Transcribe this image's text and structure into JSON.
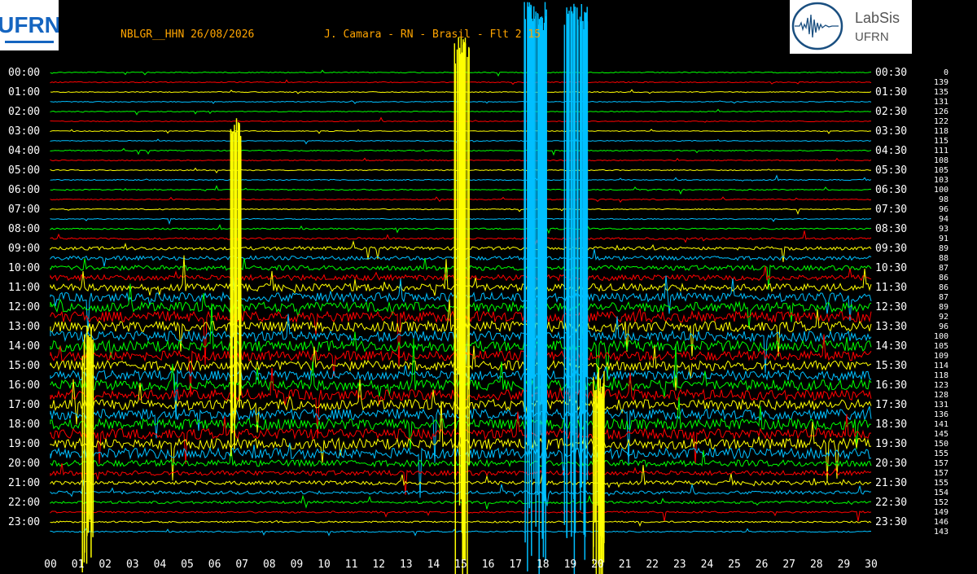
{
  "header": {
    "station": "NBLGR__HHN 26/08/2026",
    "location": "J. Camara - RN - Brasil - Flt 2 15"
  },
  "logos": {
    "left_text": "UFRN",
    "right_line1": "LabSis",
    "right_line2": "UFRN"
  },
  "chart_data": {
    "type": "helicorder",
    "station": "NBLGR__HHN",
    "date": "26/08/2026",
    "x_minutes": [
      "00",
      "01",
      "02",
      "03",
      "04",
      "05",
      "06",
      "07",
      "08",
      "09",
      "10",
      "11",
      "12",
      "13",
      "14",
      "15",
      "16",
      "17",
      "18",
      "19",
      "20",
      "21",
      "22",
      "23",
      "24",
      "25",
      "26",
      "27",
      "28",
      "29",
      "30"
    ],
    "y_left_labels": [
      "00:00",
      "01:00",
      "02:00",
      "03:00",
      "04:00",
      "05:00",
      "06:00",
      "07:00",
      "08:00",
      "09:00",
      "10:00",
      "11:00",
      "12:00",
      "13:00",
      "14:00",
      "15:00",
      "16:00",
      "17:00",
      "18:00",
      "19:00",
      "20:00",
      "21:00",
      "22:00",
      "23:00"
    ],
    "y_right_labels": [
      "00:30",
      "01:30",
      "02:30",
      "03:30",
      "04:30",
      "05:30",
      "06:30",
      "07:30",
      "08:30",
      "09:30",
      "10:30",
      "11:30",
      "12:30",
      "13:30",
      "14:30",
      "15:30",
      "16:30",
      "17:30",
      "18:30",
      "19:30",
      "20:30",
      "21:30",
      "22:30",
      "23:30"
    ],
    "trace_values": [
      "0",
      "139",
      "135",
      "131",
      "126",
      "122",
      "118",
      "115",
      "111",
      "108",
      "105",
      "103",
      "100",
      "98",
      "96",
      "94",
      "93",
      "91",
      "89",
      "88",
      "87",
      "86",
      "86",
      "87",
      "89",
      "92",
      "96",
      "100",
      "105",
      "109",
      "114",
      "118",
      "123",
      "128",
      "131",
      "136",
      "141",
      "145",
      "150",
      "155",
      "157",
      "157",
      "155",
      "154",
      "152",
      "149",
      "146",
      "143"
    ],
    "trace_colors": [
      "#00ff00",
      "#ff0000",
      "#ffff00",
      "#00bfff"
    ],
    "noise_levels": [
      0.6,
      0.6,
      0.5,
      0.5,
      0.5,
      0.5,
      0.5,
      0.5,
      0.6,
      0.6,
      0.6,
      0.6,
      0.6,
      0.6,
      0.6,
      0.6,
      0.9,
      1.2,
      2.0,
      2.5,
      3.0,
      3.5,
      4.5,
      5.5,
      6.0,
      6.5,
      6.5,
      6.5,
      6.5,
      6.0,
      6.0,
      6.0,
      6.5,
      6.5,
      6.5,
      6.5,
      6.5,
      6.5,
      6.5,
      6.5,
      4.0,
      3.0,
      2.5,
      2.0,
      1.6,
      1.2,
      1.0,
      0.8
    ]
  }
}
